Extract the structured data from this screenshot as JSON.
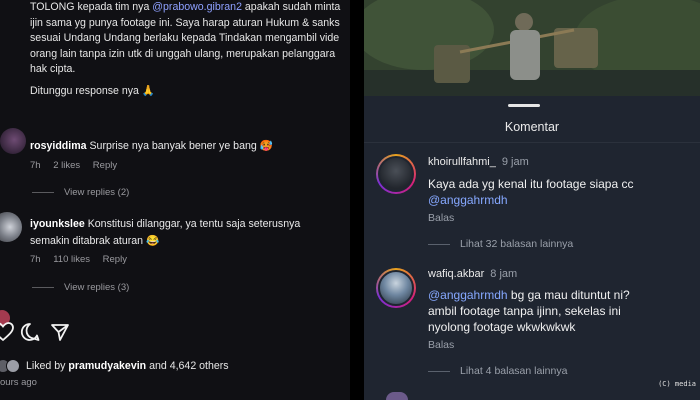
{
  "left_panel": {
    "post_caption_lines": [
      {
        "pre": "TOLONG kepada tim nya ",
        "mention": "@prabowo.gibran2",
        "post": " apakah sudah minta"
      },
      {
        "pre": "ijin sama yg punya footage ini. Saya harap aturan Hukum & sanks",
        "mention": "",
        "post": ""
      },
      {
        "pre": "sesuai Undang Undang berlaku kepada Tindakan mengambil vide",
        "mention": "",
        "post": ""
      },
      {
        "pre": "orang lain tanpa izin utk di unggah ulang, merupakan pelanggara",
        "mention": "",
        "post": ""
      },
      {
        "pre": "hak cipta.",
        "mention": "",
        "post": ""
      }
    ],
    "waiting_line": "Ditunggu response nya 🙏",
    "comments": [
      {
        "username": "rosyiddima",
        "text": "Surprise nya banyak bener ye bang 🥵",
        "time": "7h",
        "likes": "2 likes",
        "reply": "Reply",
        "view_replies": "View replies (2)"
      },
      {
        "username": "iyounkslee",
        "text_line1": "Konstitusi dilanggar, ya tentu saja seterusnya",
        "text_line2": "semakin ditabrak aturan 😂",
        "time": "7h",
        "likes": "110 likes",
        "reply": "Reply",
        "view_replies": "View replies (3)"
      }
    ],
    "actions": {
      "heart": "heart-icon",
      "comment": "comment-icon",
      "share": "share-icon"
    },
    "liked_by": {
      "prefix": "Liked by ",
      "user": "pramudyakevin",
      "suffix": " and 4,642 others"
    },
    "time_ago": "ours ago"
  },
  "right_panel": {
    "sheet_title": "Komentar",
    "comments": [
      {
        "username": "khoirullfahmi_",
        "time": "9 jam",
        "text_line1": "Kaya ada yg kenal itu footage siapa cc",
        "mention_line2": "@anggahrmdh",
        "reply": "Balas",
        "more_replies": "Lihat 32 balasan lainnya"
      },
      {
        "username": "wafiq.akbar",
        "time": "8 jam",
        "mention": "@anggahrmdh",
        "text_line1_rest": " bg ga mau dituntut ni?",
        "text_line2": "ambil footage tanpa ijinn, sekelas ini",
        "text_line3": "nyolong footage wkwkwkwk",
        "reply": "Balas",
        "more_replies": "Lihat 4 balasan lainnya"
      }
    ]
  },
  "watermark": "(C) media",
  "colors": {
    "left_bg": "#101014",
    "sheet_bg": "#1f2530",
    "mention": "#8ea0ff",
    "muted": "#9a9a9f"
  }
}
